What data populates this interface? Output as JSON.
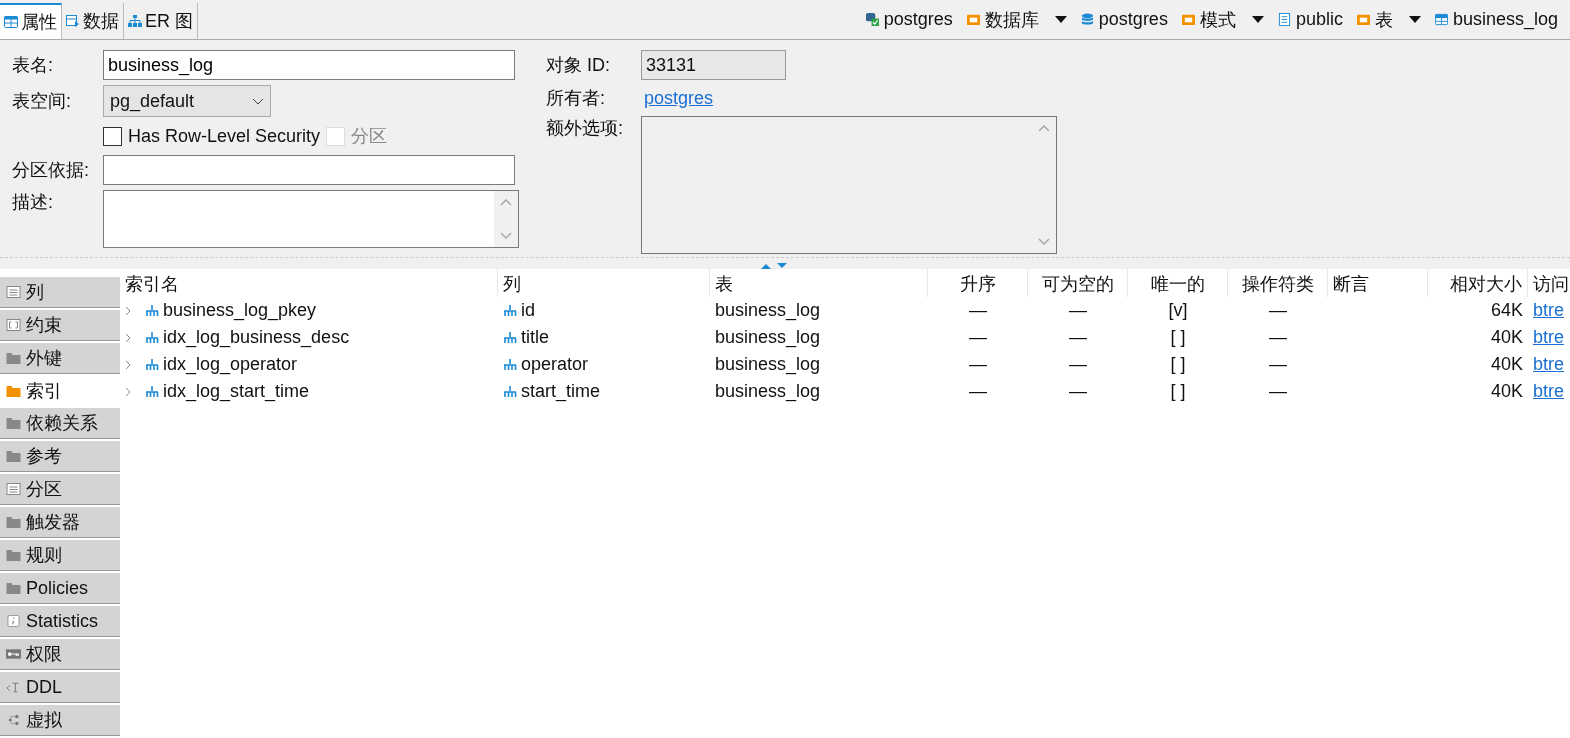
{
  "tabs": [
    {
      "label": "属性",
      "selected": true
    },
    {
      "label": "数据",
      "selected": false
    },
    {
      "label": "ER 图",
      "selected": false
    }
  ],
  "breadcrumb": [
    {
      "label": "postgres",
      "has_menu": false
    },
    {
      "label": "数据库",
      "has_menu": true
    },
    {
      "label": "postgres",
      "has_menu": false
    },
    {
      "label": "模式",
      "has_menu": true
    },
    {
      "label": "public",
      "has_menu": false
    },
    {
      "label": "表",
      "has_menu": true
    },
    {
      "label": "business_log",
      "has_menu": false
    }
  ],
  "form": {
    "table_name": {
      "label": "表名:",
      "value": "business_log"
    },
    "tablespace": {
      "label": "表空间:",
      "value": "pg_default"
    },
    "row_level_security": {
      "label": "Has Row-Level Security",
      "checked": false,
      "disabled": false
    },
    "partitioned": {
      "label": "分区",
      "checked": false,
      "disabled": true
    },
    "partition_by": {
      "label": "分区依据:"
    },
    "description": {
      "label": "描述:"
    },
    "object_id": {
      "label": "对象 ID:",
      "value": "33131"
    },
    "owner": {
      "label": "所有者:",
      "value": "postgres"
    },
    "extra_options": {
      "label": "额外选项:"
    }
  },
  "sidebar": {
    "items": [
      {
        "label": "列",
        "selected": false
      },
      {
        "label": "约束",
        "selected": false
      },
      {
        "label": "外键",
        "selected": false
      },
      {
        "label": "索引",
        "selected": true
      },
      {
        "label": "依赖关系",
        "selected": false
      },
      {
        "label": "参考",
        "selected": false
      },
      {
        "label": "分区",
        "selected": false
      },
      {
        "label": "触发器",
        "selected": false
      },
      {
        "label": "规则",
        "selected": false
      },
      {
        "label": "Policies",
        "selected": false
      },
      {
        "label": "Statistics",
        "selected": false
      },
      {
        "label": "权限",
        "selected": false
      },
      {
        "label": "DDL",
        "selected": false
      },
      {
        "label": "虚拟",
        "selected": false
      }
    ]
  },
  "table": {
    "columns": [
      "索引名",
      "列",
      "表",
      "升序",
      "可为空的",
      "唯一的",
      "操作符类",
      "断言",
      "相对大小",
      "访问"
    ],
    "rows": [
      {
        "expanded": false,
        "cells": [
          "business_log_pkey",
          "id",
          "business_log",
          "—",
          "—",
          "[v]",
          "—",
          "",
          "64K",
          "btre"
        ]
      },
      {
        "expanded": false,
        "cells": [
          "idx_log_business_desc",
          "title",
          "business_log",
          "—",
          "—",
          "[ ]",
          "—",
          "",
          "40K",
          "btre"
        ]
      },
      {
        "expanded": false,
        "cells": [
          "idx_log_operator",
          "operator",
          "business_log",
          "—",
          "—",
          "[ ]",
          "—",
          "",
          "40K",
          "btre"
        ]
      },
      {
        "expanded": false,
        "cells": [
          "idx_log_start_time",
          "start_time",
          "business_log",
          "—",
          "—",
          "[ ]",
          "—",
          "",
          "40K",
          "btre"
        ]
      }
    ]
  }
}
